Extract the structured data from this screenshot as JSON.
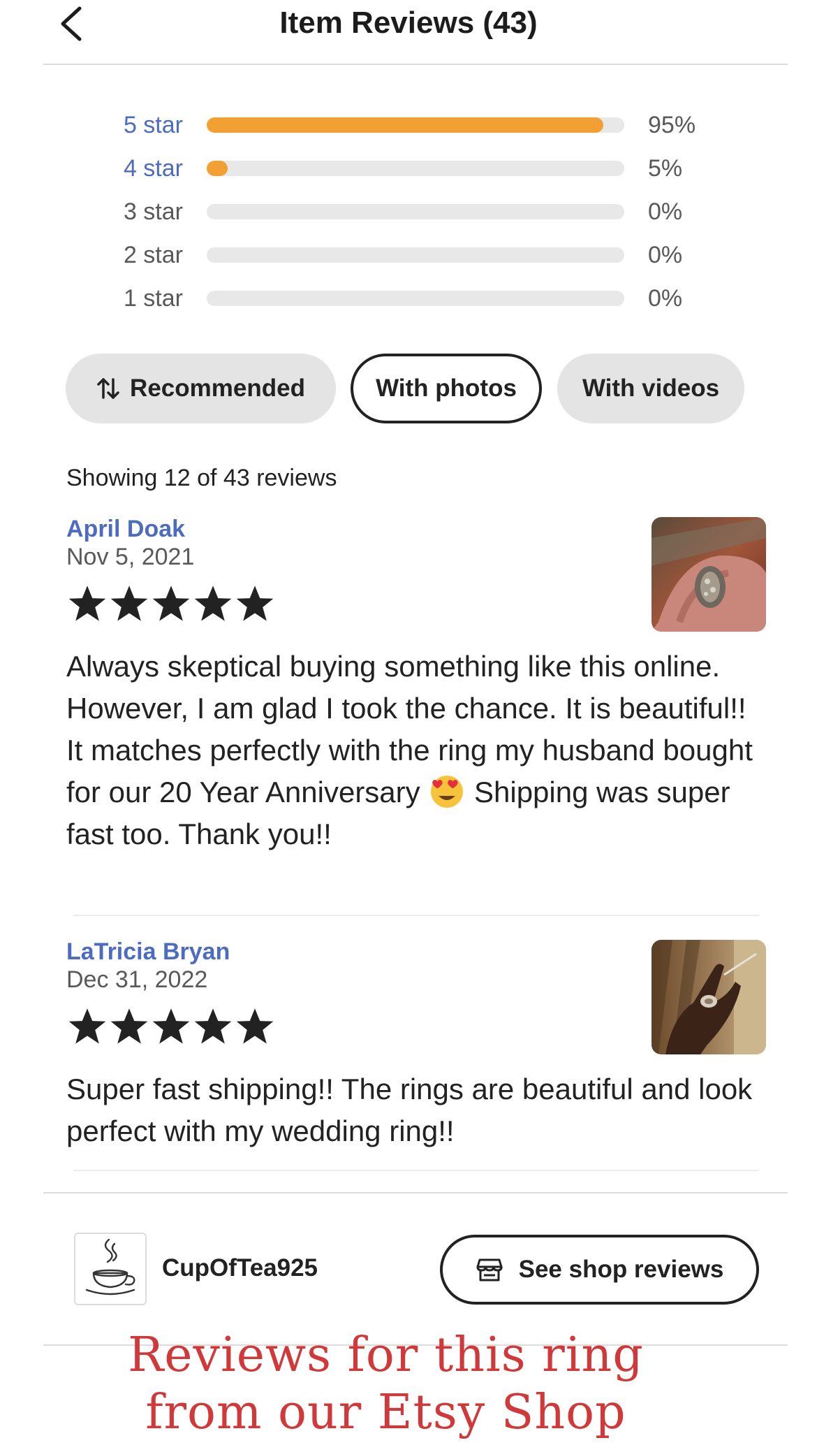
{
  "header": {
    "title": "Item Reviews (43)",
    "back_icon": "chevron-left-icon"
  },
  "rating_breakdown": [
    {
      "label": "5 star",
      "percent_text": "95%",
      "fill_fraction": 0.95,
      "highlighted": true
    },
    {
      "label": "4 star",
      "percent_text": "5%",
      "fill_fraction": 0.05,
      "highlighted": true
    },
    {
      "label": "3 star",
      "percent_text": "0%",
      "fill_fraction": 0.0,
      "highlighted": false
    },
    {
      "label": "2 star",
      "percent_text": "0%",
      "fill_fraction": 0.0,
      "highlighted": false
    },
    {
      "label": "1 star",
      "percent_text": "0%",
      "fill_fraction": 0.0,
      "highlighted": false
    }
  ],
  "filters": [
    {
      "label": "Recommended",
      "icon": "sort-arrows-icon",
      "selected": false
    },
    {
      "label": "With photos",
      "selected": true
    },
    {
      "label": "With videos",
      "selected": false
    }
  ],
  "showing_text": "Showing 12 of 43 reviews",
  "reviews": [
    {
      "reviewer": "April Doak",
      "date": "Nov 5, 2021",
      "rating": 5,
      "text_before_emoji": "Always skeptical buying something like this online. However, I am glad I took the chance. It is beautiful!! It matches perfectly with the ring my husband bought for our 20 Year Anniversary",
      "emoji": "heart-eyes-emoji",
      "text_after_emoji": "Shipping was super fast too. Thank you!!",
      "photo": "ring-on-hand-photo"
    },
    {
      "reviewer": "LaTricia Bryan",
      "date": "Dec 31, 2022",
      "rating": 5,
      "text": "Super fast shipping!! The rings are beautiful and look perfect with my wedding ring!!",
      "photo": "ring-on-hand-photo"
    }
  ],
  "shop": {
    "name": "CupOfTea925",
    "logo_icon": "teacup-logo-icon",
    "button_label": "See shop reviews",
    "button_icon": "shop-icon"
  },
  "caption": {
    "line1": "Reviews for this ring",
    "line2": "from our Etsy Shop"
  },
  "colors": {
    "accent_blue": "#4d6bc1",
    "bar_orange": "#f2a033",
    "bar_track": "#e8e8e8",
    "caption_red": "#d0383a"
  }
}
